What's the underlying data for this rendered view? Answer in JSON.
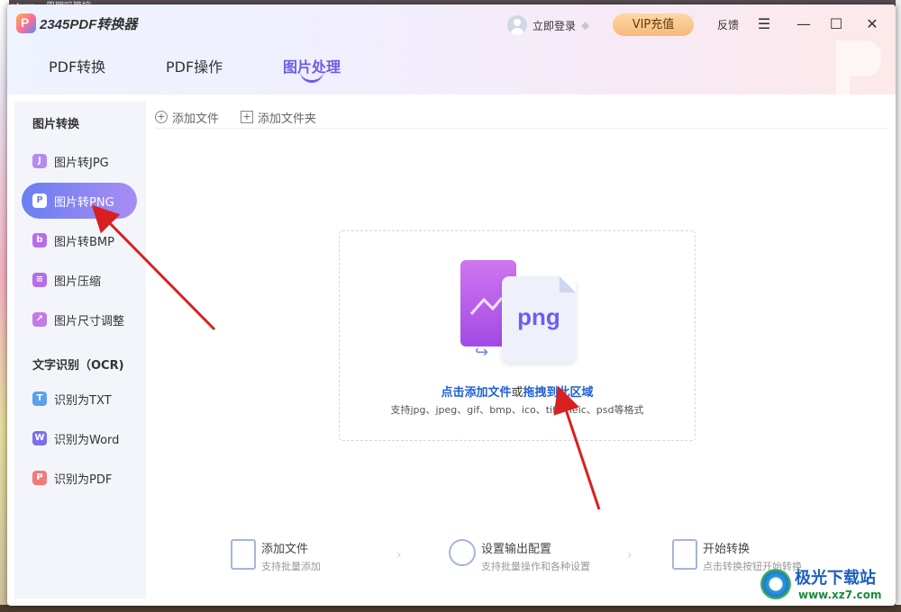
{
  "desktop": {
    "top_text": "capture... 周期吗管控"
  },
  "app": {
    "title": "2345PDF转换器",
    "logo_letter": "P"
  },
  "header": {
    "login_label": "立即登录",
    "vip_label": "VIP充值",
    "feedback_label": "反馈",
    "menu_icon": "☰",
    "minimize_icon": "—",
    "maximize_icon": "☐",
    "close_icon": "✕"
  },
  "tabs": [
    {
      "label": "PDF转换",
      "active": false
    },
    {
      "label": "PDF操作",
      "active": false
    },
    {
      "label": "图片处理",
      "active": true
    }
  ],
  "sidebar": {
    "section1": "图片转换",
    "section2": "文字识别（OCR)",
    "items": [
      {
        "label": "图片转JPG",
        "icon": "J",
        "color": "#b48cf0"
      },
      {
        "label": "图片转PNG",
        "icon": "P",
        "color": "#6a7ff2",
        "active": true
      },
      {
        "label": "图片转BMP",
        "icon": "b",
        "color": "#b56ee8"
      },
      {
        "label": "图片压缩",
        "icon": "≡",
        "color": "#b56ee8"
      },
      {
        "label": "图片尺寸调整",
        "icon": "↗",
        "color": "#c07be6"
      },
      {
        "label": "识别为TXT",
        "icon": "T",
        "color": "#5aa0f0"
      },
      {
        "label": "识别为Word",
        "icon": "W",
        "color": "#7a6ff0"
      },
      {
        "label": "识别为PDF",
        "icon": "P",
        "color": "#f07a7a"
      }
    ]
  },
  "toolbar": {
    "add_file": "添加文件",
    "add_folder": "添加文件夹"
  },
  "dropzone": {
    "file_ext": "png",
    "main_part1": "点击添加文件",
    "main_part2": "或",
    "main_part3": "拖拽到此区域",
    "sub": "支持jpg、jpeg、gif、bmp、ico、tif、heic、psd等格式"
  },
  "steps": [
    {
      "title": "添加文件",
      "sub": "支持批量添加"
    },
    {
      "title": "设置输出配置",
      "sub": "支持批量操作和各种设置"
    },
    {
      "title": "开始转换",
      "sub": "点击转换按钮开始转换"
    }
  ],
  "watermark": {
    "text": "极光下载站",
    "url": "www.xz7.com"
  }
}
